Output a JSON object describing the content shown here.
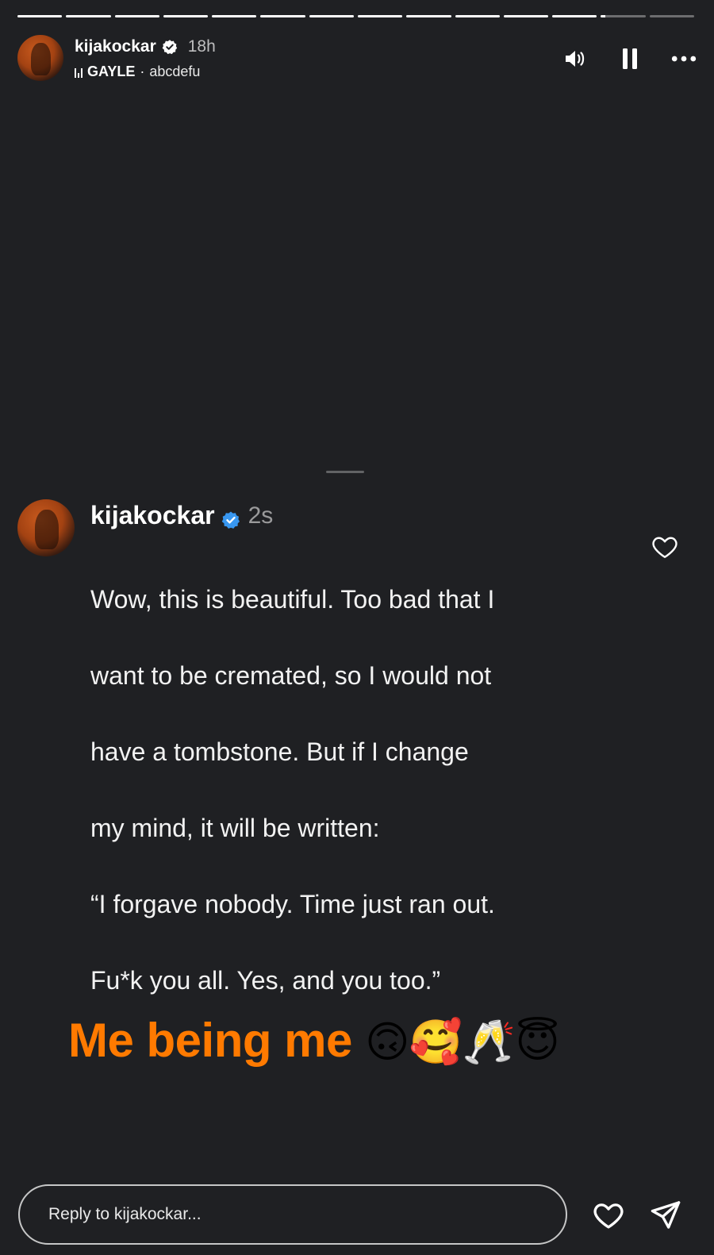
{
  "story": {
    "segments_total": 14,
    "segments_complete": 12,
    "segments_current_progress": 0.1
  },
  "header": {
    "username": "kijakockar",
    "time": "18h",
    "music_artist": "GAYLE",
    "music_separator": "·",
    "music_song": "abcdefu",
    "icons": [
      "volume-icon",
      "pause-icon",
      "more-icon"
    ]
  },
  "comment": {
    "username": "kijakockar",
    "time": "2s",
    "text_lines": [
      "Wow, this is beautiful. Too bad that I",
      "want to be cremated, so I would not",
      "have a tombstone. But if I change",
      "my mind, it will be written:",
      "“I forgave nobody. Time just ran out.",
      "Fu*k you all. Yes, and you too.”"
    ],
    "verified_color": "#3897f0"
  },
  "caption": {
    "text": "Me being me",
    "emojis": "🙃🥰🥂😇",
    "color": "#ff7a00"
  },
  "footer": {
    "reply_placeholder": "Reply to kijakockar..."
  }
}
